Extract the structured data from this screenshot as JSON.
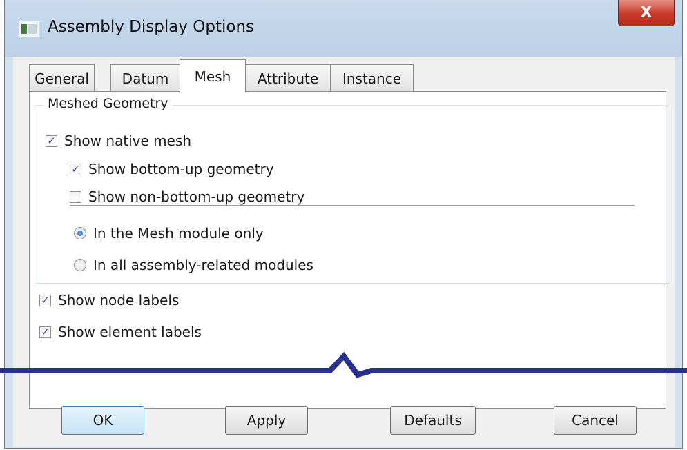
{
  "window": {
    "title": "Assembly Display Options",
    "close_label": "X"
  },
  "tabs": [
    {
      "label": "General",
      "active": false
    },
    {
      "label": "Datum",
      "active": false
    },
    {
      "label": "Mesh",
      "active": true
    },
    {
      "label": "Attribute",
      "active": false
    },
    {
      "label": "Instance",
      "active": false
    }
  ],
  "meshed_geometry": {
    "legend": "Meshed Geometry",
    "show_native_mesh": {
      "label": "Show native mesh",
      "checked": true
    },
    "show_bottom_up": {
      "label": "Show bottom-up geometry",
      "checked": true
    },
    "show_non_bottom_up": {
      "label": "Show non-bottom-up geometry",
      "checked": false
    },
    "radio_mesh_only": {
      "label": "In the Mesh module only",
      "selected": true
    },
    "radio_all_modules": {
      "label": "In all assembly-related modules",
      "selected": false
    }
  },
  "labels": {
    "show_node_labels": {
      "label": "Show node labels",
      "checked": true
    },
    "show_element_labels": {
      "label": "Show element labels",
      "checked": true
    }
  },
  "buttons": {
    "ok": "OK",
    "apply": "Apply",
    "defaults": "Defaults",
    "cancel": "Cancel"
  },
  "colors": {
    "break_line": "#28318c",
    "titlebar": "#c4d7ea",
    "close": "#c73a27"
  }
}
